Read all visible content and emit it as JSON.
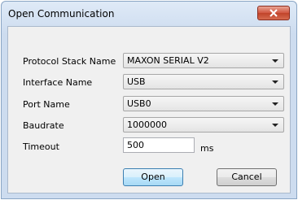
{
  "window": {
    "title": "Open Communication"
  },
  "form": {
    "protocol_label": "Protocol Stack Name",
    "protocol_value": "MAXON SERIAL V2",
    "interface_label": "Interface Name",
    "interface_value": "USB",
    "port_label": "Port Name",
    "port_value": "USB0",
    "baudrate_label": "Baudrate",
    "baudrate_value": "1000000",
    "timeout_label": "Timeout",
    "timeout_value": "500",
    "timeout_unit": "ms"
  },
  "buttons": {
    "open_label": "Open",
    "cancel_label": "Cancel"
  },
  "icons": {
    "close": "close-icon",
    "dropdown": "chevron-down-icon"
  },
  "colors": {
    "close_button": "#c7432b",
    "client_bg": "#f0f0f0"
  }
}
